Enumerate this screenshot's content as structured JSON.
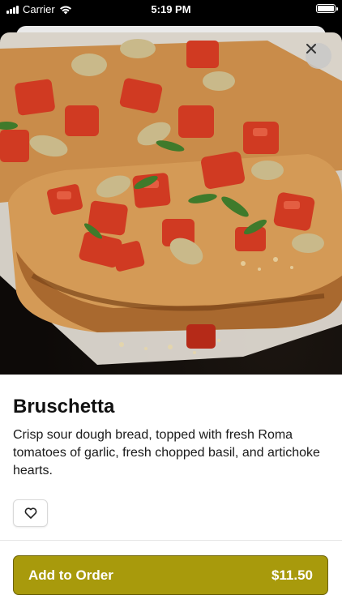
{
  "status_bar": {
    "carrier": "Carrier",
    "time": "5:19 PM"
  },
  "item": {
    "image_alt_name": "bruschetta-photo",
    "title": "Bruschetta",
    "description": "Crisp sour dough bread, topped with fresh Roma tomatoes of garlic, fresh chopped basil, and artichoke hearts."
  },
  "actions": {
    "add_label": "Add to Order",
    "price": "$11.50"
  },
  "colors": {
    "accent": "#a89a0c",
    "accent_border": "#6b6105"
  },
  "icons": {
    "close": "close-icon",
    "favorite": "heart-icon"
  }
}
